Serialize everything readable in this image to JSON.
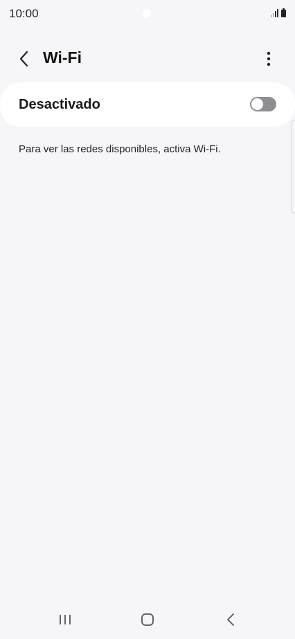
{
  "status_bar": {
    "time": "10:00",
    "icons": [
      "signal-icon",
      "battery-icon"
    ]
  },
  "header": {
    "title": "Wi-Fi",
    "back_icon": "chevron-left-icon",
    "more_icon": "more-vertical-icon"
  },
  "wifi_toggle": {
    "label": "Desactivado",
    "state": "off",
    "track_color": "#8e8e93",
    "knob_color": "#ffffff"
  },
  "hint": "Para ver las redes disponibles, activa Wi-Fi.",
  "nav_bar": {
    "buttons": [
      "recent-apps-icon",
      "home-icon",
      "back-icon"
    ]
  },
  "colors": {
    "background": "#f6f6f8",
    "card": "#ffffff",
    "text": "#111111"
  }
}
